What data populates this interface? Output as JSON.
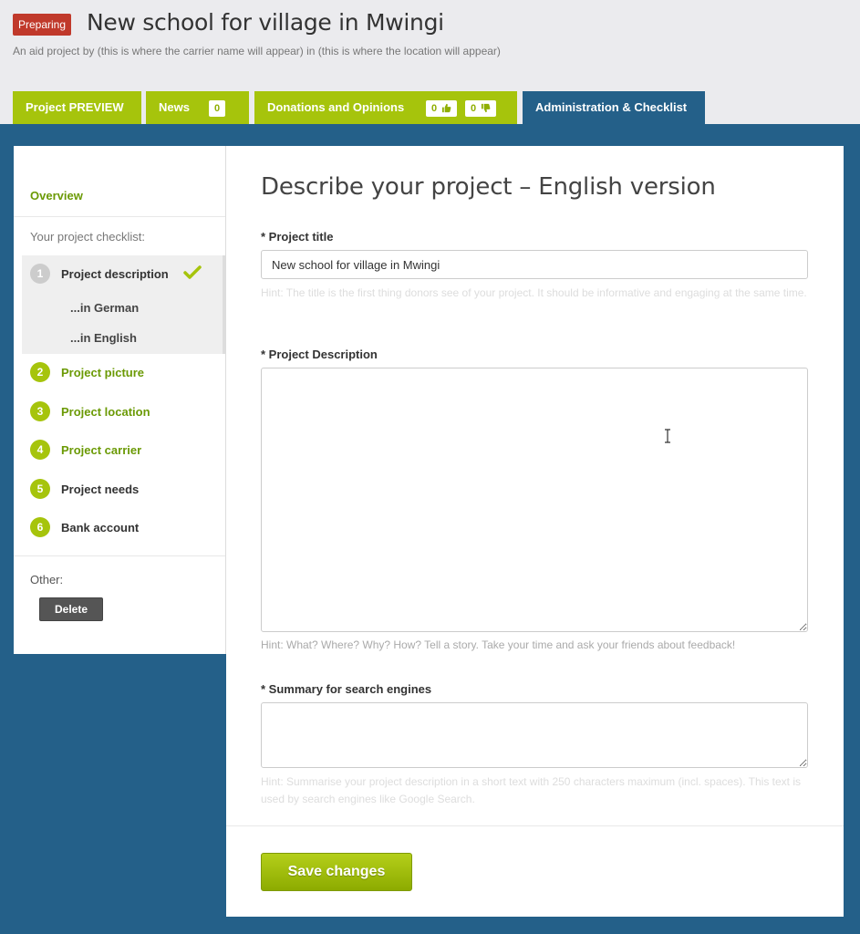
{
  "header": {
    "status_badge": "Preparing",
    "title": "New school for village in Mwingi",
    "subtitle": "An aid project by (this is where the carrier name will appear) in (this is where the location will appear)"
  },
  "tabs": [
    {
      "label": "Project PREVIEW"
    },
    {
      "label": "News",
      "count": "0"
    },
    {
      "label": "Donations and Opinions",
      "likes": "0",
      "dislikes": "0"
    },
    {
      "label": "Administration & Checklist",
      "active": true
    }
  ],
  "sidebar": {
    "overview": "Overview",
    "checklist_label": "Your project checklist:",
    "steps": [
      {
        "num": "1",
        "label": "Project description",
        "done": true
      },
      {
        "num": "2",
        "label": "Project picture"
      },
      {
        "num": "3",
        "label": "Project location"
      },
      {
        "num": "4",
        "label": "Project carrier"
      },
      {
        "num": "5",
        "label": "Project needs"
      },
      {
        "num": "6",
        "label": "Bank account"
      }
    ],
    "sub_steps": [
      "...in German",
      "...in English"
    ],
    "other_label": "Other:",
    "delete_label": "Delete"
  },
  "form": {
    "heading": "Describe your project – English version",
    "title_label": "* Project title",
    "title_value": "New school for village in Mwingi",
    "title_hint": "Hint: The title is the first thing donors see of your project. It should be informative and engaging at the same time.",
    "description_label": "* Project Description",
    "description_value": "",
    "description_hint": "Hint: What? Where? Why? How? Tell a story. Take your time and ask your friends about feedback!",
    "summary_label": "* Summary for search engines",
    "summary_value": "",
    "summary_hint": "Hint: Summarise your project description in a short text with 250 characters maximum (incl. spaces). This text is used by search engines like Google Search.",
    "save_label": "Save changes"
  },
  "colors": {
    "accent_green": "#a6c40c",
    "active_tab_blue": "#246089",
    "badge_red": "#c0392b"
  }
}
